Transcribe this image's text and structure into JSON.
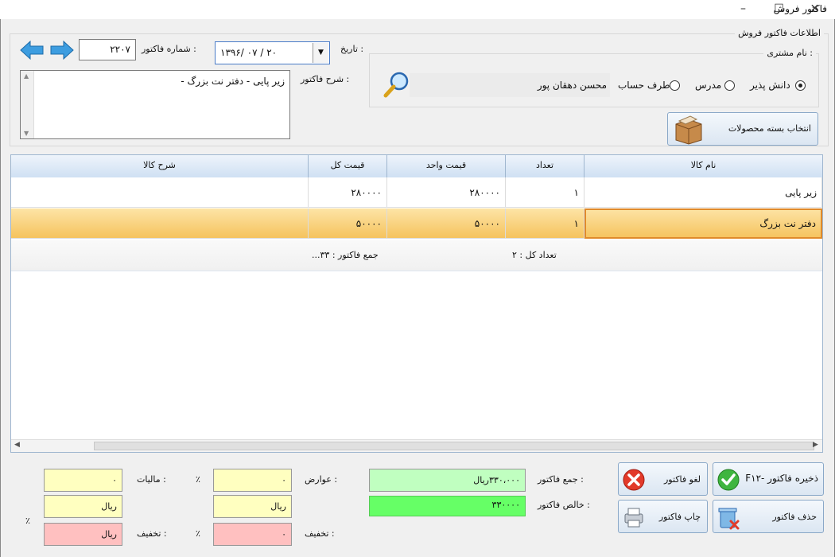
{
  "window": {
    "title": "فاکتور فروش",
    "minimize": "–",
    "maximize": "☐",
    "close": "✕"
  },
  "info": {
    "legend": "اطلاعات فاکتور فروش",
    "invoice_number_label": "شماره فاکتور :",
    "invoice_number": "۲۲۰۷",
    "date_label": "تاریخ :",
    "date_value": "۱۳۹۶/ ۰۷ / ۲۰",
    "description_label": "شرح فاکتور :",
    "description_value": "زیر پایی  -  دفتر نت بزرگ  -",
    "customer_legend": "نام مشتری :",
    "radios": [
      {
        "label": "دانش پذیر",
        "selected": true
      },
      {
        "label": "مدرس",
        "selected": false
      },
      {
        "label": "طرف حساب",
        "selected": false
      }
    ],
    "customer_name": "محسن  دهقان پور",
    "select_package": "انتخاب بسته محصولات"
  },
  "grid": {
    "headers": [
      "نام کالا",
      "تعداد",
      "قیمت واحد",
      "قیمت کل",
      "شرح کالا"
    ],
    "rows": [
      {
        "name": "زیر پایی",
        "qty": "۱",
        "unit": "۲۸۰۰۰۰",
        "total": "۲۸۰۰۰۰",
        "desc": ""
      },
      {
        "name": "دفتر نت بزرگ",
        "qty": "۱",
        "unit": "۵۰۰۰۰",
        "total": "۵۰۰۰۰",
        "desc": ""
      }
    ],
    "summary_count": "تعداد کل : ۲",
    "summary_total": "جمع فاکتور : ۳۳..."
  },
  "totals": {
    "invoice_sum_label": "جمع فاکتور :",
    "invoice_sum": "۳۳۰،۰۰۰ریال",
    "net_label": "خالص فاکتور :",
    "net": "۳۳۰۰۰۰",
    "duties_label": "عوارض :",
    "duties": "۰",
    "duties_rial": "ریال",
    "discount_label": "تخفیف :",
    "discount": "۰",
    "tax_label": "مالیات :",
    "tax": "۰",
    "tax_rial": "ریال",
    "discount2_label": "تخفیف :",
    "discount2": "ریال",
    "percent": "٪"
  },
  "buttons": {
    "save": "ذخیره فاکتور -F۱۲",
    "cancel": "لغو فاکتور",
    "delete": "حذف فاکتور",
    "print": "چاپ فاکتور"
  },
  "colors": {
    "selected_row": "#f5c25c",
    "grid_header": "#cfe0f3",
    "net_green": "#66ff66"
  }
}
